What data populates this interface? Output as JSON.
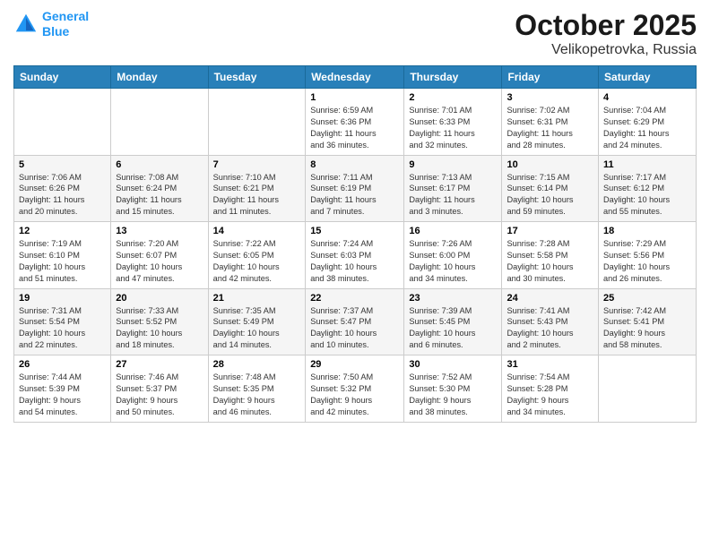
{
  "logo": {
    "line1": "General",
    "line2": "Blue"
  },
  "title": "October 2025",
  "subtitle": "Velikopetrovka, Russia",
  "header_days": [
    "Sunday",
    "Monday",
    "Tuesday",
    "Wednesday",
    "Thursday",
    "Friday",
    "Saturday"
  ],
  "weeks": [
    [
      {
        "day": "",
        "info": ""
      },
      {
        "day": "",
        "info": ""
      },
      {
        "day": "",
        "info": ""
      },
      {
        "day": "1",
        "info": "Sunrise: 6:59 AM\nSunset: 6:36 PM\nDaylight: 11 hours\nand 36 minutes."
      },
      {
        "day": "2",
        "info": "Sunrise: 7:01 AM\nSunset: 6:33 PM\nDaylight: 11 hours\nand 32 minutes."
      },
      {
        "day": "3",
        "info": "Sunrise: 7:02 AM\nSunset: 6:31 PM\nDaylight: 11 hours\nand 28 minutes."
      },
      {
        "day": "4",
        "info": "Sunrise: 7:04 AM\nSunset: 6:29 PM\nDaylight: 11 hours\nand 24 minutes."
      }
    ],
    [
      {
        "day": "5",
        "info": "Sunrise: 7:06 AM\nSunset: 6:26 PM\nDaylight: 11 hours\nand 20 minutes."
      },
      {
        "day": "6",
        "info": "Sunrise: 7:08 AM\nSunset: 6:24 PM\nDaylight: 11 hours\nand 15 minutes."
      },
      {
        "day": "7",
        "info": "Sunrise: 7:10 AM\nSunset: 6:21 PM\nDaylight: 11 hours\nand 11 minutes."
      },
      {
        "day": "8",
        "info": "Sunrise: 7:11 AM\nSunset: 6:19 PM\nDaylight: 11 hours\nand 7 minutes."
      },
      {
        "day": "9",
        "info": "Sunrise: 7:13 AM\nSunset: 6:17 PM\nDaylight: 11 hours\nand 3 minutes."
      },
      {
        "day": "10",
        "info": "Sunrise: 7:15 AM\nSunset: 6:14 PM\nDaylight: 10 hours\nand 59 minutes."
      },
      {
        "day": "11",
        "info": "Sunrise: 7:17 AM\nSunset: 6:12 PM\nDaylight: 10 hours\nand 55 minutes."
      }
    ],
    [
      {
        "day": "12",
        "info": "Sunrise: 7:19 AM\nSunset: 6:10 PM\nDaylight: 10 hours\nand 51 minutes."
      },
      {
        "day": "13",
        "info": "Sunrise: 7:20 AM\nSunset: 6:07 PM\nDaylight: 10 hours\nand 47 minutes."
      },
      {
        "day": "14",
        "info": "Sunrise: 7:22 AM\nSunset: 6:05 PM\nDaylight: 10 hours\nand 42 minutes."
      },
      {
        "day": "15",
        "info": "Sunrise: 7:24 AM\nSunset: 6:03 PM\nDaylight: 10 hours\nand 38 minutes."
      },
      {
        "day": "16",
        "info": "Sunrise: 7:26 AM\nSunset: 6:00 PM\nDaylight: 10 hours\nand 34 minutes."
      },
      {
        "day": "17",
        "info": "Sunrise: 7:28 AM\nSunset: 5:58 PM\nDaylight: 10 hours\nand 30 minutes."
      },
      {
        "day": "18",
        "info": "Sunrise: 7:29 AM\nSunset: 5:56 PM\nDaylight: 10 hours\nand 26 minutes."
      }
    ],
    [
      {
        "day": "19",
        "info": "Sunrise: 7:31 AM\nSunset: 5:54 PM\nDaylight: 10 hours\nand 22 minutes."
      },
      {
        "day": "20",
        "info": "Sunrise: 7:33 AM\nSunset: 5:52 PM\nDaylight: 10 hours\nand 18 minutes."
      },
      {
        "day": "21",
        "info": "Sunrise: 7:35 AM\nSunset: 5:49 PM\nDaylight: 10 hours\nand 14 minutes."
      },
      {
        "day": "22",
        "info": "Sunrise: 7:37 AM\nSunset: 5:47 PM\nDaylight: 10 hours\nand 10 minutes."
      },
      {
        "day": "23",
        "info": "Sunrise: 7:39 AM\nSunset: 5:45 PM\nDaylight: 10 hours\nand 6 minutes."
      },
      {
        "day": "24",
        "info": "Sunrise: 7:41 AM\nSunset: 5:43 PM\nDaylight: 10 hours\nand 2 minutes."
      },
      {
        "day": "25",
        "info": "Sunrise: 7:42 AM\nSunset: 5:41 PM\nDaylight: 9 hours\nand 58 minutes."
      }
    ],
    [
      {
        "day": "26",
        "info": "Sunrise: 7:44 AM\nSunset: 5:39 PM\nDaylight: 9 hours\nand 54 minutes."
      },
      {
        "day": "27",
        "info": "Sunrise: 7:46 AM\nSunset: 5:37 PM\nDaylight: 9 hours\nand 50 minutes."
      },
      {
        "day": "28",
        "info": "Sunrise: 7:48 AM\nSunset: 5:35 PM\nDaylight: 9 hours\nand 46 minutes."
      },
      {
        "day": "29",
        "info": "Sunrise: 7:50 AM\nSunset: 5:32 PM\nDaylight: 9 hours\nand 42 minutes."
      },
      {
        "day": "30",
        "info": "Sunrise: 7:52 AM\nSunset: 5:30 PM\nDaylight: 9 hours\nand 38 minutes."
      },
      {
        "day": "31",
        "info": "Sunrise: 7:54 AM\nSunset: 5:28 PM\nDaylight: 9 hours\nand 34 minutes."
      },
      {
        "day": "",
        "info": ""
      }
    ]
  ]
}
